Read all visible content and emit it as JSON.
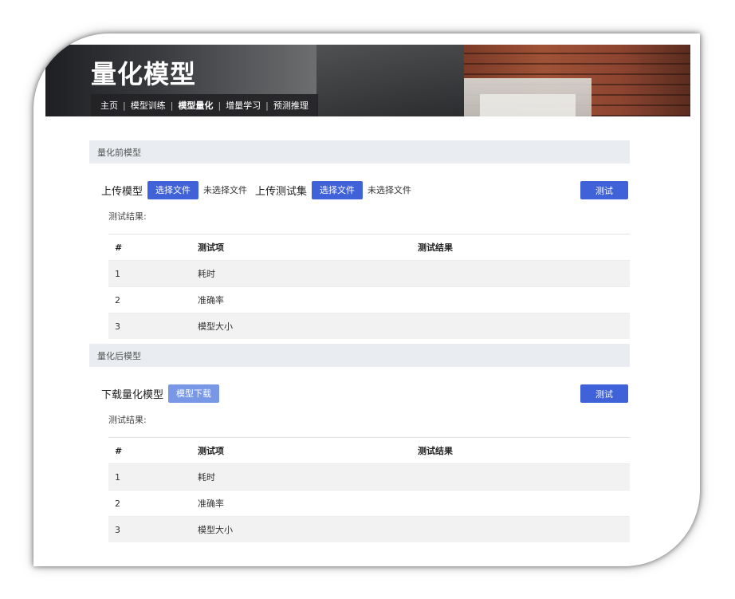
{
  "page": {
    "title": "量化模型",
    "nav": [
      {
        "label": "主页",
        "active": false
      },
      {
        "label": "模型训练",
        "active": false
      },
      {
        "label": "模型量化",
        "active": true
      },
      {
        "label": "增量学习",
        "active": false
      },
      {
        "label": "预测推理",
        "active": false
      }
    ]
  },
  "pre_quant": {
    "section_title": "量化前模型",
    "upload_model_label": "上传模型",
    "choose_file_label": "选择文件",
    "no_file_text": "未选择文件",
    "upload_testset_label": "上传测试集",
    "choose_file_label_2": "选择文件",
    "no_file_text_2": "未选择文件",
    "test_button": "测试",
    "result_label": "测试结果:",
    "table": {
      "headers": [
        "#",
        "测试项",
        "测试结果"
      ],
      "rows": [
        {
          "idx": "1",
          "item": "耗时",
          "result": ""
        },
        {
          "idx": "2",
          "item": "准确率",
          "result": ""
        },
        {
          "idx": "3",
          "item": "模型大小",
          "result": ""
        }
      ]
    }
  },
  "post_quant": {
    "section_title": "量化后模型",
    "download_label": "下载量化模型",
    "download_button": "模型下载",
    "test_button": "测试",
    "result_label": "测试结果:",
    "table": {
      "headers": [
        "#",
        "测试项",
        "测试结果"
      ],
      "rows": [
        {
          "idx": "1",
          "item": "耗时",
          "result": ""
        },
        {
          "idx": "2",
          "item": "准确率",
          "result": ""
        },
        {
          "idx": "3",
          "item": "模型大小",
          "result": ""
        }
      ]
    }
  },
  "colors": {
    "primary_button": "#4062d8",
    "download_button": "#7897e6",
    "section_bar": "#e9edf1"
  }
}
